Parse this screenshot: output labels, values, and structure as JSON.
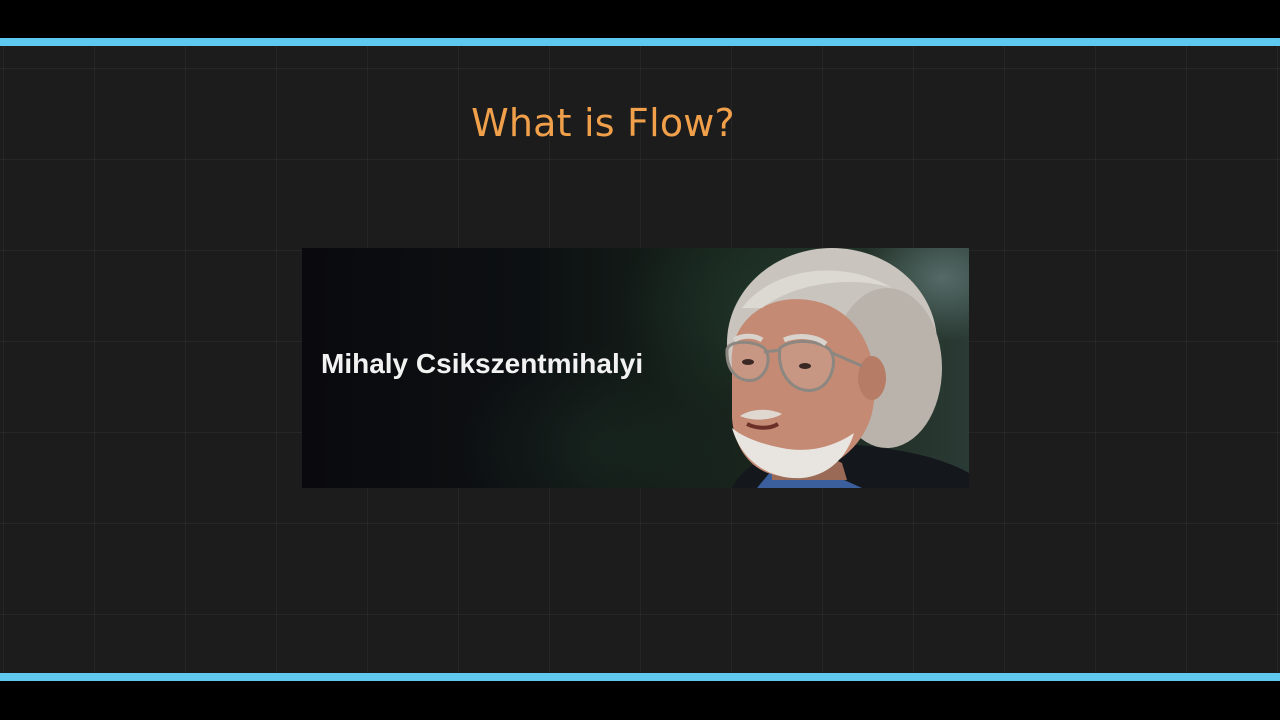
{
  "slide": {
    "title": "What is Flow?",
    "photo": {
      "caption": "Mihaly Csikszentmihalyi"
    }
  },
  "colors": {
    "accent_line": "#5ec8ee",
    "title": "#f0a04a",
    "background": "#1c1c1c"
  }
}
